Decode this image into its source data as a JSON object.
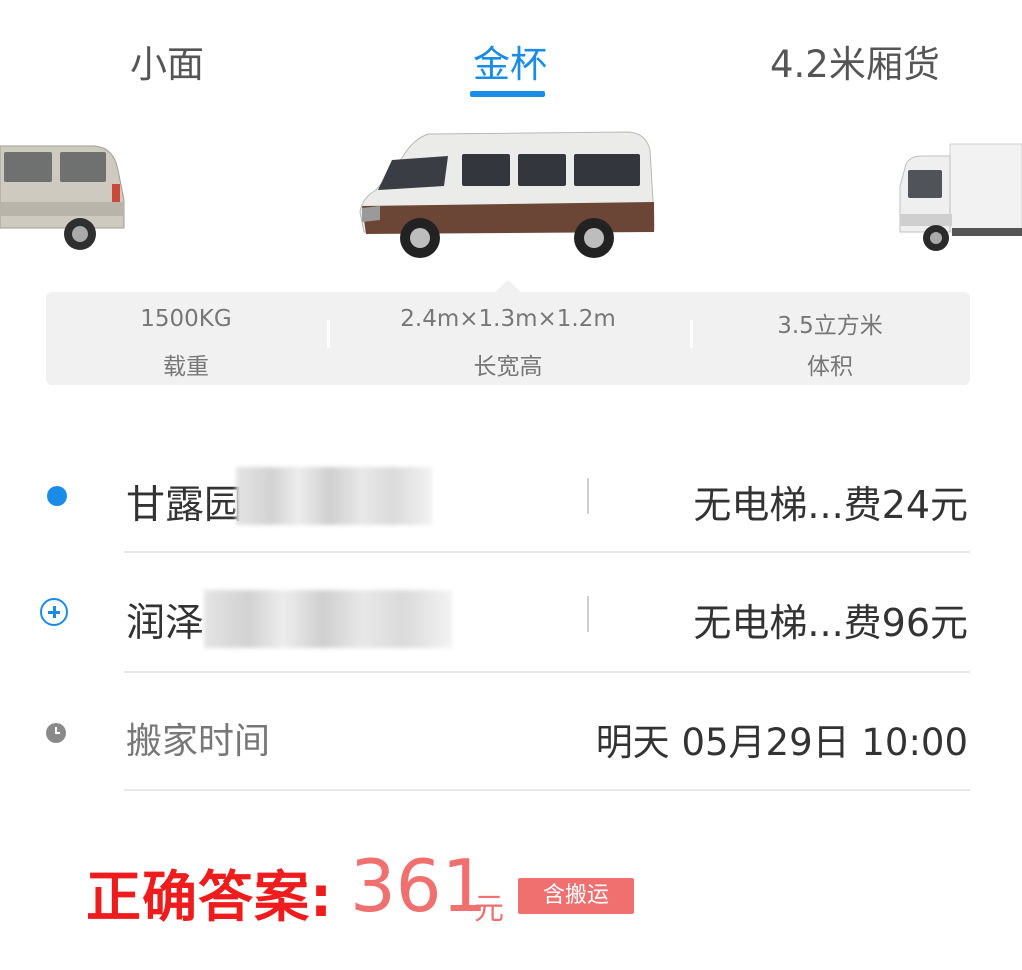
{
  "tabs": [
    {
      "label": "小面",
      "active": false
    },
    {
      "label": "金杯",
      "active": true
    },
    {
      "label": "4.2米厢货",
      "active": false
    }
  ],
  "specs": [
    {
      "value": "1500KG",
      "label": "载重"
    },
    {
      "value": "2.4m×1.3m×1.2m",
      "label": "长宽高"
    },
    {
      "value": "3.5立方米",
      "label": "体积"
    }
  ],
  "addresses": [
    {
      "name": "甘露园",
      "fee": "无电梯...费24元"
    },
    {
      "name": "润泽",
      "fee": "无电梯...费96元"
    }
  ],
  "move_time": {
    "label": "搬家时间",
    "value": "明天 05月29日 10:00"
  },
  "answer": {
    "label": "正确答案:",
    "price": "361",
    "unit": "元",
    "badge": "含搬运"
  },
  "colors": {
    "accent": "#1a8ce8",
    "answer_red": "#ee1c1c",
    "price_pink": "#f07070"
  }
}
